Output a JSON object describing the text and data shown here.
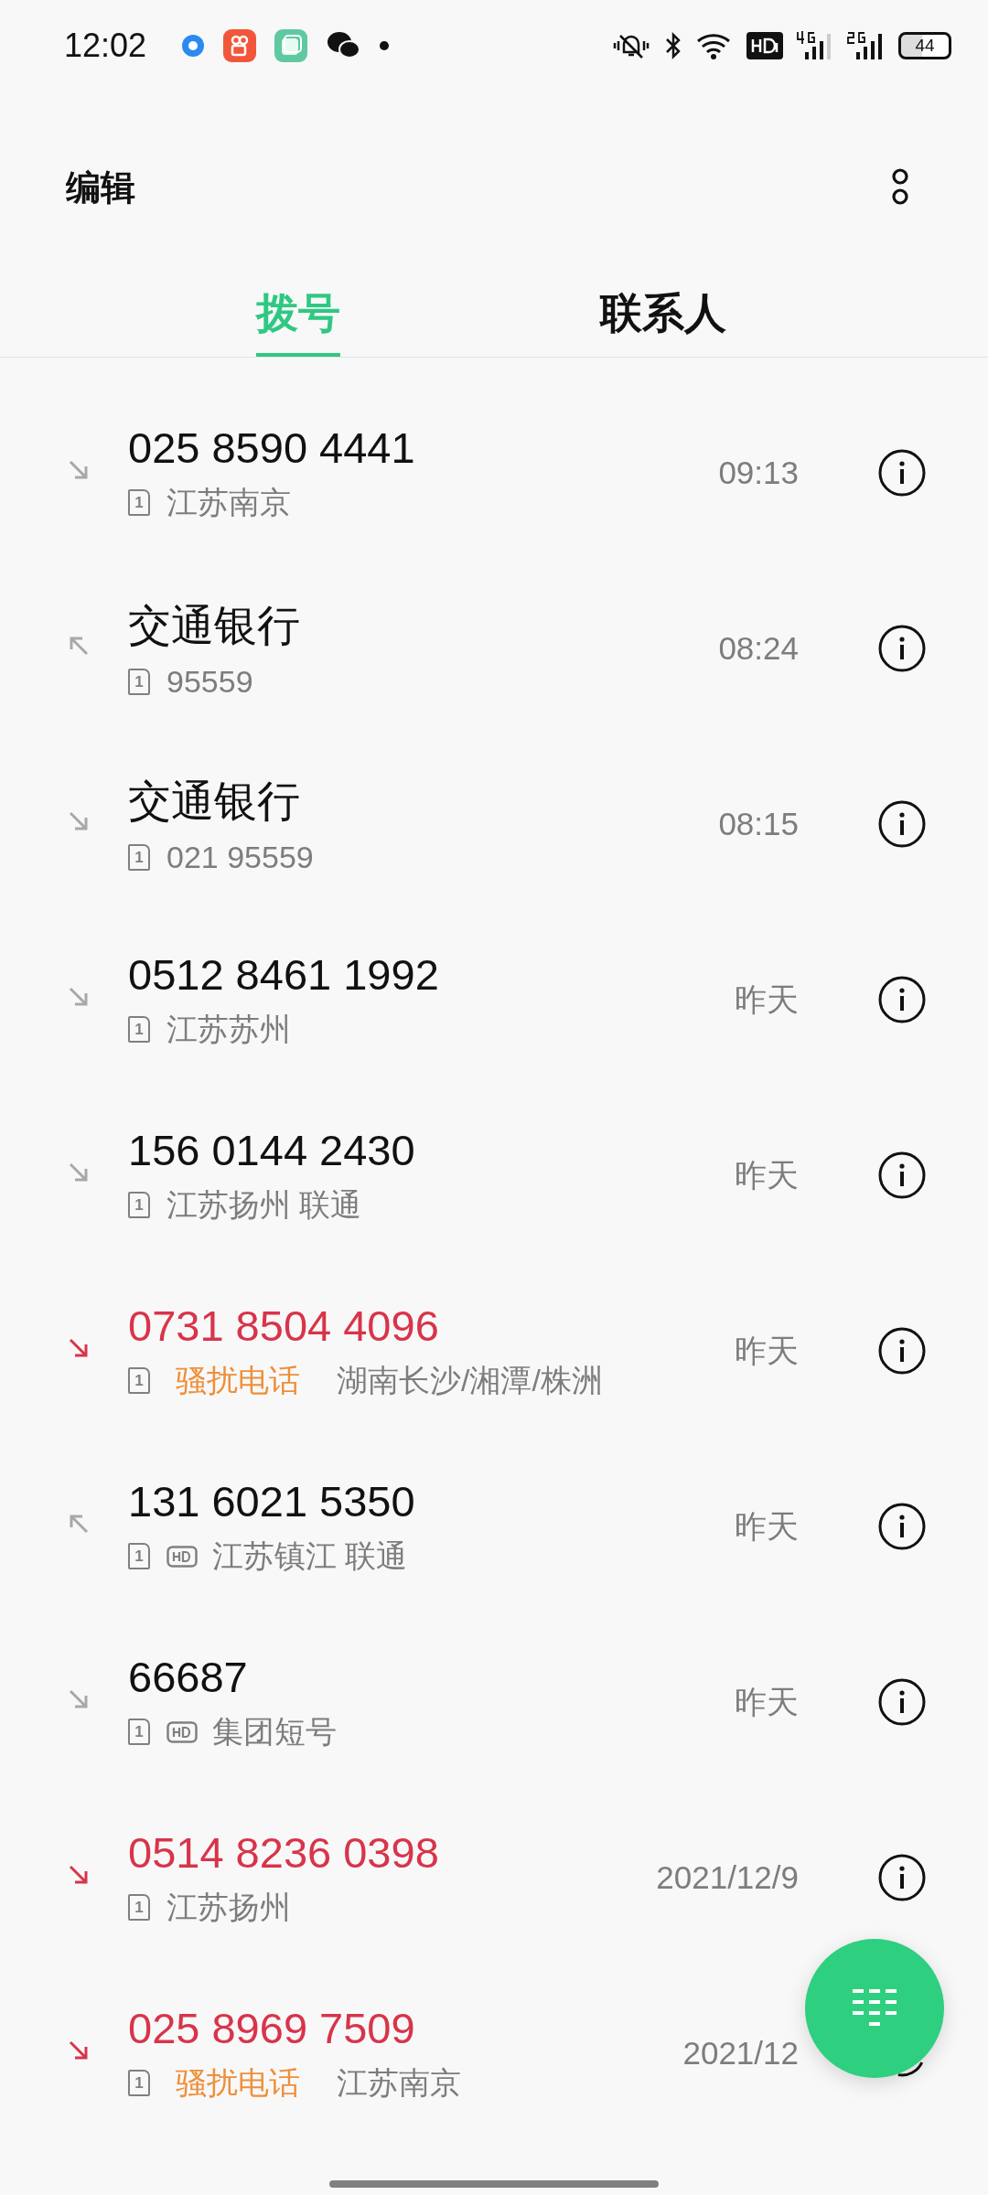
{
  "status_bar": {
    "time": "12:02",
    "battery": "44"
  },
  "header": {
    "title": "编辑"
  },
  "tabs": [
    {
      "label": "拨号",
      "selected": true
    },
    {
      "label": "联系人",
      "selected": false
    }
  ],
  "calls": [
    {
      "kind": "incoming",
      "number": "025 8590 4441",
      "sim": "1",
      "hd": false,
      "location": "江苏南京",
      "time": "09:13"
    },
    {
      "kind": "outgoing",
      "number": "交通银行",
      "sim": "1",
      "hd": false,
      "location": "95559",
      "time": "08:24"
    },
    {
      "kind": "incoming",
      "number": "交通银行",
      "sim": "1",
      "hd": false,
      "location": "021 95559",
      "time": "08:15"
    },
    {
      "kind": "incoming",
      "number": "0512 8461 1992",
      "sim": "1",
      "hd": false,
      "location": "江苏苏州",
      "time": "昨天"
    },
    {
      "kind": "incoming",
      "number": "156 0144 2430",
      "sim": "1",
      "hd": false,
      "location": "江苏扬州 联通",
      "time": "昨天"
    },
    {
      "kind": "missed",
      "number": "0731 8504 4096",
      "sim": "1",
      "hd": false,
      "tag": "骚扰电话",
      "location": "湖南长沙/湘潭/株洲",
      "time": "昨天"
    },
    {
      "kind": "outgoing",
      "number": "131 6021 5350",
      "sim": "1",
      "hd": true,
      "location": "江苏镇江 联通",
      "time": "昨天"
    },
    {
      "kind": "incoming",
      "number": "66687",
      "sim": "1",
      "hd": true,
      "location": "集团短号",
      "time": "昨天"
    },
    {
      "kind": "missed",
      "number": "0514 8236 0398",
      "sim": "1",
      "hd": false,
      "location": "江苏扬州",
      "time": "2021/12/9"
    },
    {
      "kind": "missed",
      "number": "025 8969 7509",
      "sim": "1",
      "hd": false,
      "tag": "骚扰电话",
      "location": "江苏南京",
      "time": "2021/12"
    }
  ]
}
